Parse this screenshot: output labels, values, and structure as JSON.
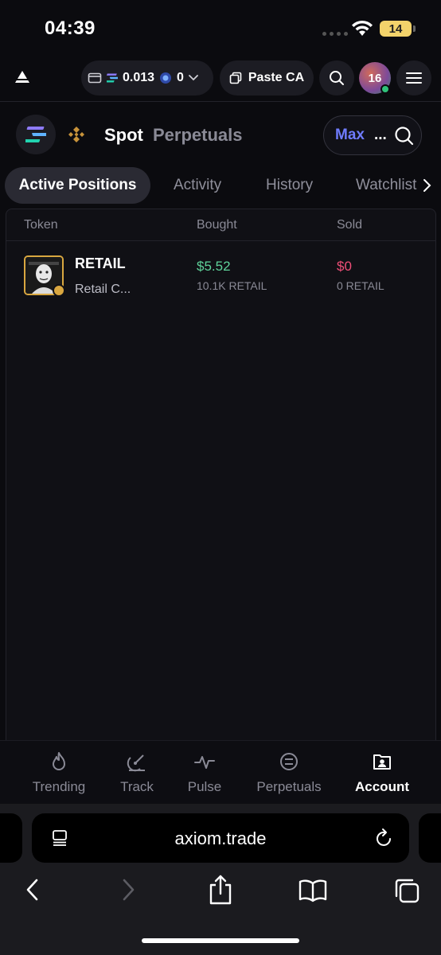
{
  "status_bar": {
    "time": "04:39",
    "battery": "14"
  },
  "header": {
    "sol_balance": "0.013",
    "points_balance": "0",
    "paste_label": "Paste CA",
    "avatar_badge": "16"
  },
  "market": {
    "spot_label": "Spot",
    "perpetuals_label": "Perpetuals",
    "max_label": "Max",
    "max_more": "..."
  },
  "tabs": [
    {
      "label": "Active Positions",
      "active": true
    },
    {
      "label": "Activity"
    },
    {
      "label": "History"
    },
    {
      "label": "Watchlist"
    }
  ],
  "table": {
    "columns": [
      "Token",
      "Bought",
      "Sold"
    ],
    "rows": [
      {
        "ticker": "RETAIL",
        "name": "Retail C...",
        "bought_usd": "$5.52",
        "bought_amount": "10.1K RETAIL",
        "sold_usd": "$0",
        "sold_amount": "0 RETAIL"
      }
    ]
  },
  "bottom_nav": [
    {
      "label": "Trending",
      "icon": "flame-icon"
    },
    {
      "label": "Track",
      "icon": "radar-icon"
    },
    {
      "label": "Pulse",
      "icon": "pulse-icon"
    },
    {
      "label": "Perpetuals",
      "icon": "swap-circle-icon"
    },
    {
      "label": "Account",
      "icon": "account-icon",
      "active": true
    }
  ],
  "browser": {
    "url": "axiom.trade"
  },
  "colors": {
    "background": "#0b0b0f",
    "accent_blue": "#6f7cff",
    "positive": "#5fd39a",
    "negative": "#f04f78",
    "token_border": "#d9a740"
  }
}
